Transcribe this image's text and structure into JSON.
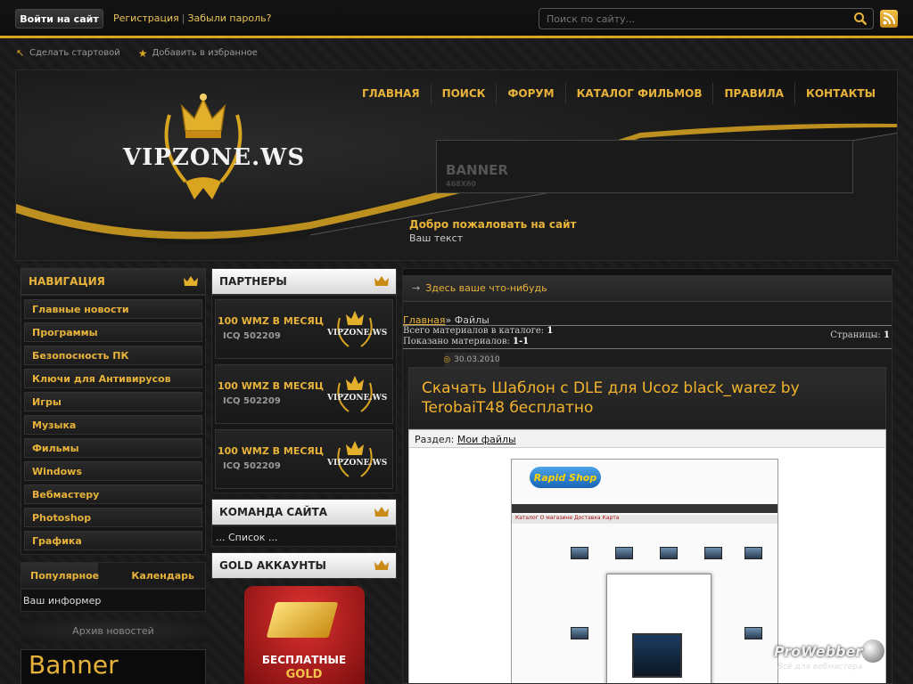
{
  "topbar": {
    "login_label": "Войти на сайт",
    "register_label": "Регистрация",
    "forgot_label": "Забыли пароль?",
    "search_placeholder": "Поиск по сайту..."
  },
  "sublinks": {
    "make_home": "Сделать стартовой",
    "add_favorites": "Добавить в избранное"
  },
  "header": {
    "logo_text": "VIPZONE.WS",
    "menu": [
      "ГЛАВНАЯ",
      "ПОИСК",
      "ФОРУМ",
      "КАТАЛОГ ФИЛЬМОВ",
      "ПРАВИЛА",
      "КОНТАКТЫ"
    ],
    "banner_title": "BANNER",
    "banner_size": "468X60",
    "welcome_title": "Добро пожаловать на сайт",
    "welcome_text": "Ваш текст"
  },
  "left": {
    "nav_title": "НАВИГАЦИЯ",
    "nav_items": [
      "Главные новости",
      "Программы",
      "Безопосность ПК",
      "Ключи для Антивирусов",
      "Игры",
      "Музыка",
      "Фильмы",
      "Windows",
      "Вебмастеру",
      "Photoshop",
      "Графика"
    ],
    "tab_popular": "Популярное",
    "tab_calendar": "Календарь",
    "informer": "Ваш информер",
    "archive": "Архив новостей",
    "banner": "Banner"
  },
  "middle": {
    "partners_title": "ПАРТНЕРЫ",
    "partners": [
      {
        "title": "100 WMZ В МЕСЯЦ",
        "icq": "ICQ 502209",
        "logo": "VIPZONE.WS"
      },
      {
        "title": "100 WMZ В МЕСЯЦ",
        "icq": "ICQ 502209",
        "logo": "VIPZONE.WS"
      },
      {
        "title": "100 WMZ В МЕСЯЦ",
        "icq": "ICQ 502209",
        "logo": "VIPZONE.WS"
      }
    ],
    "team_title": "КОМАНДА САЙТА",
    "team_text": "... Список ...",
    "gold_title": "GOLD АККАУНТЫ",
    "gold_line1": "БЕСПЛАТНЫЕ",
    "gold_line2": "GOLD"
  },
  "main": {
    "head_text": "Здесь ваше что-нибудь",
    "crumb_home": "Главная",
    "crumb_current": "» Файлы",
    "total_label": "Всего материалов в каталоге:",
    "total_value": "1",
    "shown_label": "Показано материалов:",
    "shown_value": "1-1",
    "pages_label": "Страницы:",
    "pages_value": "1",
    "post_date": "30.03.2010",
    "post_title": "Скачать Шаблон с DLE для Ucoz black_warez by TerobaiT48 бесплатно",
    "section_label": "Раздел:",
    "section_link": "Мои файлы",
    "ss_logo": "Rapid Shop",
    "ss_nav_text": "Каталог  О магазине  Доставка  Карта"
  },
  "prowebber": {
    "name": "ProWebber",
    "tagline": "Всё для вебмастера"
  },
  "colors": {
    "accent": "#e8b33a",
    "gold_border": "#d9a521"
  }
}
